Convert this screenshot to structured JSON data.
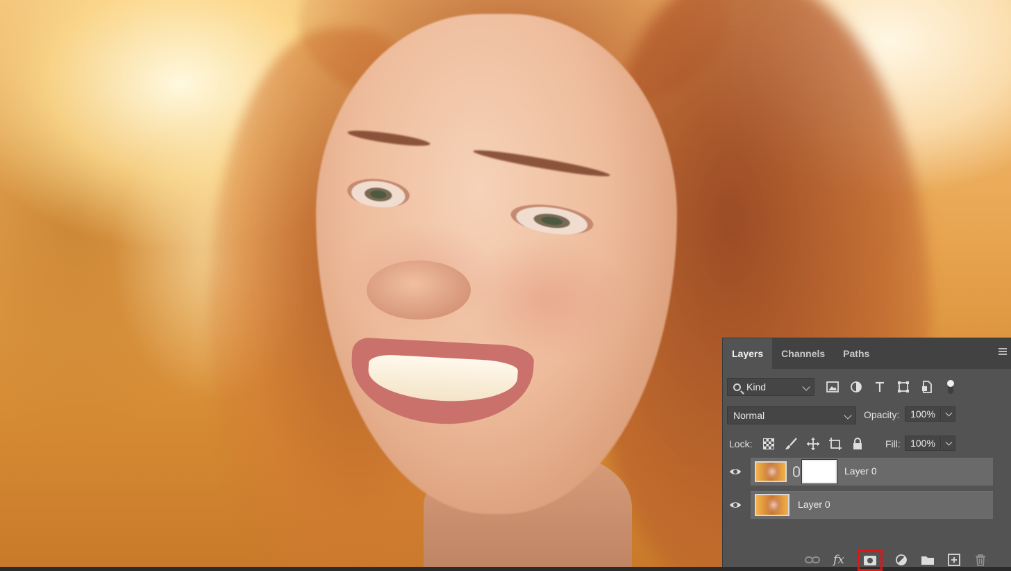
{
  "panel": {
    "tabs": [
      {
        "label": "Layers",
        "active": true
      },
      {
        "label": "Channels",
        "active": false
      },
      {
        "label": "Paths",
        "active": false
      }
    ],
    "filter": {
      "kind_value": "Kind",
      "icons": [
        "image-filter-icon",
        "adjustment-filter-icon",
        "type-filter-icon",
        "shape-filter-icon",
        "smart-object-filter-icon",
        "filter-toggle-icon"
      ]
    },
    "blend_mode": "Normal",
    "opacity_label": "Opacity:",
    "opacity_value": "100%",
    "lock_label": "Lock:",
    "lock_icons": [
      "lock-transparent-icon",
      "lock-image-icon",
      "lock-position-icon",
      "lock-artboard-icon",
      "lock-all-icon"
    ],
    "fill_label": "Fill:",
    "fill_value": "100%",
    "layers": [
      {
        "name": "Layer 0",
        "has_mask": true,
        "visible": true
      },
      {
        "name": "Layer 0",
        "has_mask": false,
        "visible": true
      }
    ],
    "bottom_icons": [
      "link-layers-icon",
      "fx-icon",
      "add-mask-icon",
      "adjustment-layer-icon",
      "group-folder-icon",
      "new-layer-icon",
      "delete-icon"
    ],
    "fx_label": "fx",
    "highlight_color": "#e01515"
  }
}
